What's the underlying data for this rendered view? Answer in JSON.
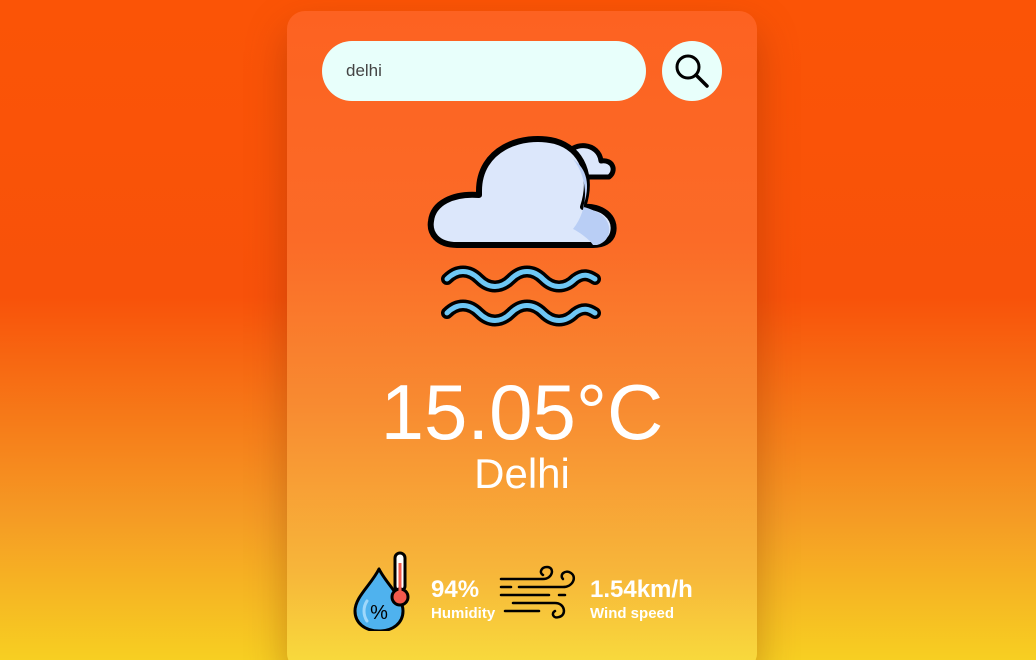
{
  "search": {
    "value": "delhi",
    "button_icon": "search-icon"
  },
  "weather": {
    "icon": "mist-cloud-icon",
    "temperature": "15.05°C",
    "city": "Delhi"
  },
  "details": {
    "humidity": {
      "icon": "humidity-icon",
      "value": "94%",
      "label": "Humidity"
    },
    "wind": {
      "icon": "wind-icon",
      "value": "1.54km/h",
      "label": "Wind speed"
    }
  },
  "colors": {
    "background_top": "#fb5406",
    "background_bottom": "#f7cf22",
    "card_top": "#fd6221",
    "card_bottom": "#f8dd3c",
    "search_bg": "#e8fffb",
    "text": "#ffffff"
  }
}
